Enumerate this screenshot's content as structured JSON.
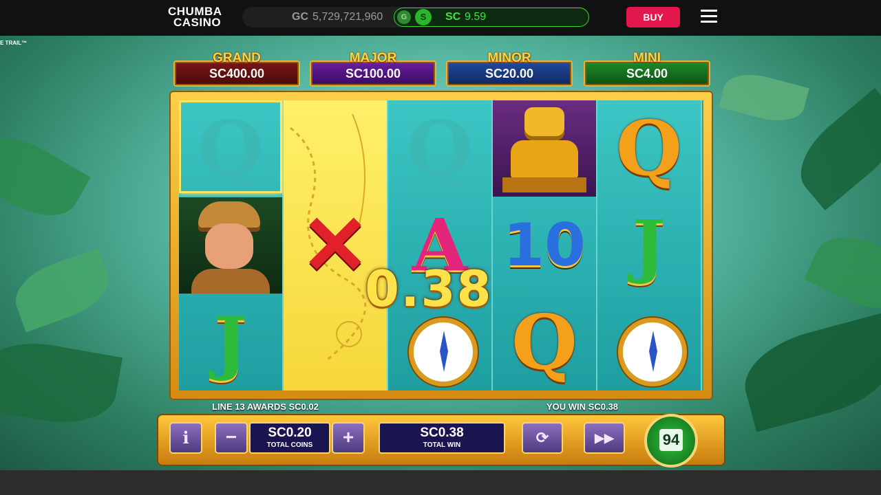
{
  "header": {
    "logo_line1": "CHUMBA",
    "logo_line2": "CASINO",
    "gc_label": "GC",
    "gc_value": "5,729,721,960",
    "toggle_gc": "G",
    "toggle_sc": "S",
    "sc_label": "SC",
    "sc_value": "9.59",
    "buy_label": "BUY"
  },
  "game": {
    "title_fragment": "E TRAIL™",
    "jackpots": [
      {
        "name": "GRAND",
        "amount": "SC400.00"
      },
      {
        "name": "MAJOR",
        "amount": "SC100.00"
      },
      {
        "name": "MINOR",
        "amount": "SC20.00"
      },
      {
        "name": "MINI",
        "amount": "SC4.00"
      }
    ],
    "reels": [
      [
        "Q",
        "explorer",
        "J"
      ],
      [
        "map-x",
        "map-x",
        "map-x"
      ],
      [
        "Q",
        "A",
        "compass"
      ],
      [
        "idol",
        "10",
        "Q"
      ],
      [
        "Q",
        "J",
        "compass"
      ]
    ],
    "reel_symbols": {
      "q": "Q",
      "j": "J",
      "a": "A",
      "ten": "10",
      "x": "✕"
    },
    "win_amount": "0.38",
    "line_message": "LINE 13 AWARDS SC0.02",
    "win_message": "YOU WIN SC0.38"
  },
  "controls": {
    "info_label": "i",
    "minus_label": "−",
    "plus_label": "+",
    "total_coins_value": "SC0.20",
    "total_coins_label": "TOTAL COINS",
    "total_win_value": "SC0.38",
    "total_win_label": "TOTAL WIN",
    "autoplay_icon": "refresh-icon",
    "turbo_icon": "fast-forward-icon",
    "spins_remaining": "94"
  },
  "colors": {
    "buy": "#e3174b",
    "sc_green": "#41e341",
    "frame_gold": "#ffc73b"
  }
}
